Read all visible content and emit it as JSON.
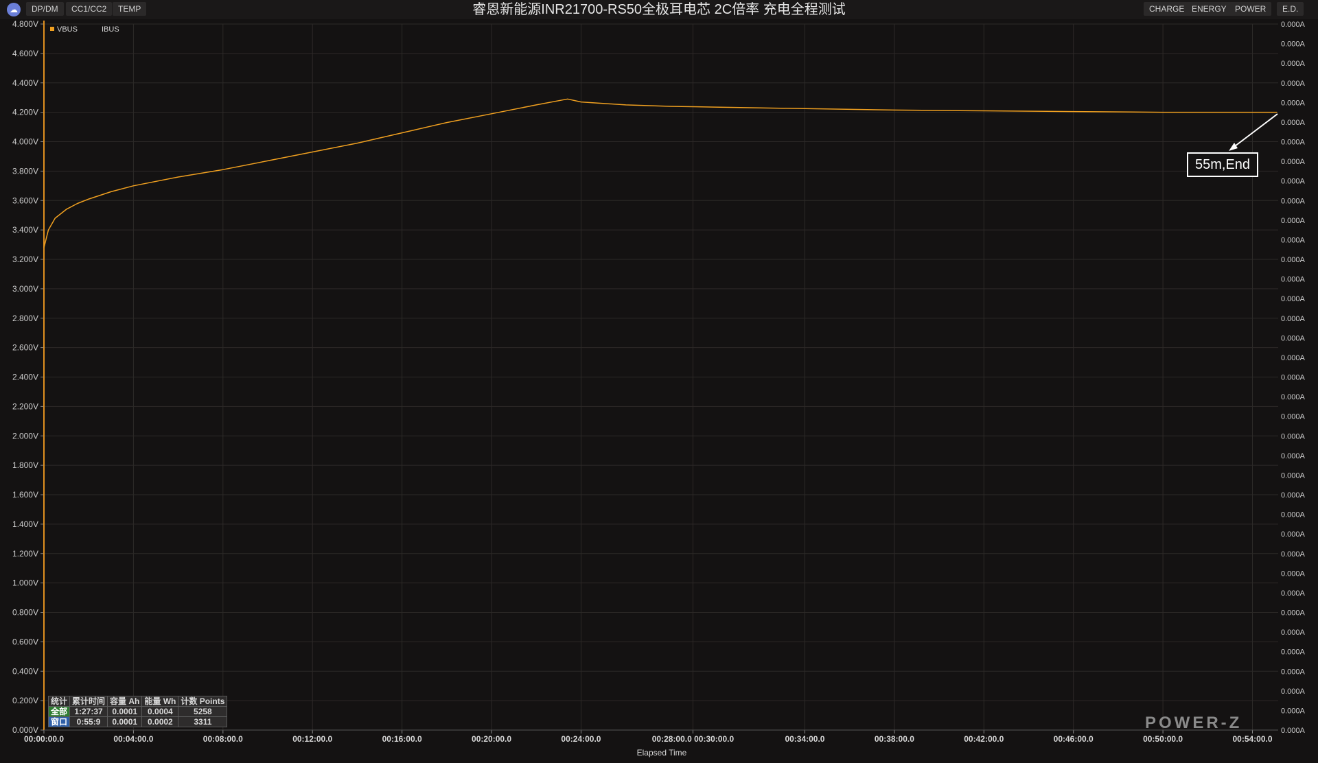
{
  "toolbar": {
    "left_tabs": [
      "DP/DM",
      "CC1/CC2",
      "TEMP"
    ],
    "right_tabs": [
      "CHARGE",
      "ENERGY",
      "POWER",
      "E.D."
    ]
  },
  "title": "睿恩新能源INR21700-RS50全极耳电芯 2C倍率 充电全程测试",
  "annotation": "55m,End",
  "stats": {
    "headers": [
      "统计",
      "累计时间",
      "容量 Ah",
      "能量 Wh",
      "计数 Points"
    ],
    "rows": [
      [
        "全部",
        "1:27:37",
        "0.0001",
        "0.0004",
        "5258"
      ],
      [
        "窗口",
        "0:55:9",
        "0.0001",
        "0.0002",
        "3311"
      ]
    ]
  },
  "logo": "POWER-Z",
  "colors": {
    "vbus": "#f0a020",
    "grid": "#2d2a28",
    "background": "#141212"
  },
  "chart_data": {
    "type": "line",
    "xlabel": "Elapsed Time",
    "ylabel": "",
    "ylim": [
      0,
      4.8
    ],
    "xlim": [
      0,
      55.15
    ],
    "y_ticks": [
      "0.000V",
      "0.200V",
      "0.400V",
      "0.600V",
      "0.800V",
      "1.000V",
      "1.200V",
      "1.400V",
      "1.600V",
      "1.800V",
      "2.000V",
      "2.200V",
      "2.400V",
      "2.600V",
      "2.800V",
      "3.000V",
      "3.200V",
      "3.400V",
      "3.600V",
      "3.800V",
      "4.000V",
      "4.200V",
      "4.400V",
      "4.600V",
      "4.800V"
    ],
    "y_right_ticks": [
      "0.000A",
      "0.000A",
      "0.000A",
      "0.000A",
      "0.000A",
      "0.000A",
      "0.000A",
      "0.000A",
      "0.000A",
      "0.000A",
      "0.000A",
      "0.000A",
      "0.000A",
      "0.000A",
      "0.000A",
      "0.000A",
      "0.000A",
      "0.000A",
      "0.000A",
      "0.000A",
      "0.000A",
      "0.000A",
      "0.000A",
      "0.000A",
      "0.000A",
      "0.000A",
      "0.000A",
      "0.000A",
      "0.000A",
      "0.000A",
      "0.000A",
      "0.000A",
      "0.000A",
      "0.000A",
      "0.000A",
      "0.000A",
      "0.000A"
    ],
    "x_ticks": [
      {
        "value": 0,
        "label": "00:00:00.0"
      },
      {
        "value": 4,
        "label": "00:04:00.0"
      },
      {
        "value": 8,
        "label": "00:08:00.0"
      },
      {
        "value": 12,
        "label": "00:12:00.0"
      },
      {
        "value": 16,
        "label": "00:16:00.0"
      },
      {
        "value": 20,
        "label": "00:20:00.0"
      },
      {
        "value": 24,
        "label": "00:24:00.0"
      },
      {
        "value": 29,
        "label": "00:28:00.0 00:30:00.0"
      },
      {
        "value": 34,
        "label": "00:34:00.0"
      },
      {
        "value": 38,
        "label": "00:38:00.0"
      },
      {
        "value": 42,
        "label": "00:42:00.0"
      },
      {
        "value": 46,
        "label": "00:46:00.0"
      },
      {
        "value": 50,
        "label": "00:50:00.0"
      },
      {
        "value": 54,
        "label": "00:54:00.0"
      }
    ],
    "legend": [
      "VBUS",
      "IBUS"
    ],
    "legend_position": "top-left",
    "grid": true,
    "series": [
      {
        "name": "VBUS",
        "x": [
          0,
          0.2,
          0.5,
          1,
          1.5,
          2,
          3,
          4,
          6,
          8,
          10,
          12,
          14,
          16,
          18,
          20,
          22,
          23.4,
          24,
          26,
          28,
          30,
          34,
          38,
          42,
          46,
          50,
          55.1
        ],
        "y": [
          3.28,
          3.4,
          3.48,
          3.54,
          3.58,
          3.61,
          3.66,
          3.7,
          3.76,
          3.81,
          3.87,
          3.93,
          3.99,
          4.06,
          4.13,
          4.19,
          4.25,
          4.29,
          4.27,
          4.25,
          4.24,
          4.235,
          4.225,
          4.215,
          4.21,
          4.205,
          4.2,
          4.2
        ]
      },
      {
        "name": "IBUS",
        "x": [],
        "y": []
      }
    ]
  }
}
